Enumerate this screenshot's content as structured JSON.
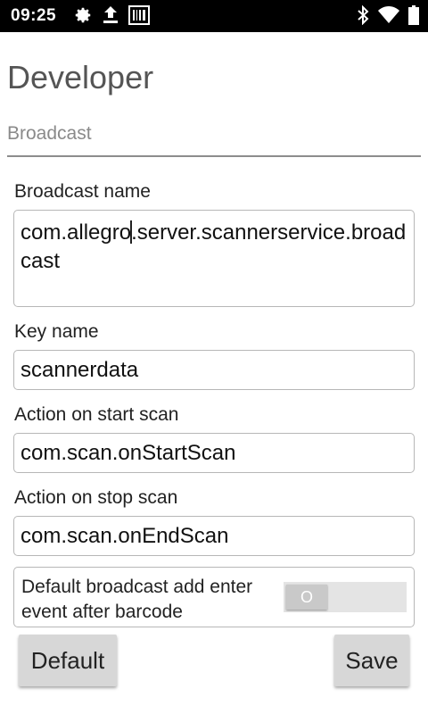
{
  "status_bar": {
    "time": "09:25",
    "left_icons": [
      "settings-icon",
      "upload-icon",
      "barcode-icon"
    ],
    "right_icons": [
      "bluetooth-icon",
      "wifi-icon",
      "battery-icon"
    ]
  },
  "page": {
    "title": "Developer",
    "section": "Broadcast"
  },
  "fields": {
    "broadcast_name": {
      "label": "Broadcast name",
      "value_before_cursor": "com.allegro",
      "value_after_cursor": ".server.scannerservice.broadcast"
    },
    "key_name": {
      "label": "Key name",
      "value": "scannerdata"
    },
    "start_scan": {
      "label": "Action on start scan",
      "value": "com.scan.onStartScan"
    },
    "stop_scan": {
      "label": "Action on stop scan",
      "value": "com.scan.onEndScan"
    }
  },
  "toggle": {
    "label": "Default broadcast add enter event after barcode",
    "state_text": "O",
    "on": false
  },
  "buttons": {
    "default_label": "Default",
    "save_label": "Save"
  },
  "colors": {
    "status_bar_bg": "#000000",
    "title": "#555555",
    "footer_warning": "#d23a3a"
  }
}
